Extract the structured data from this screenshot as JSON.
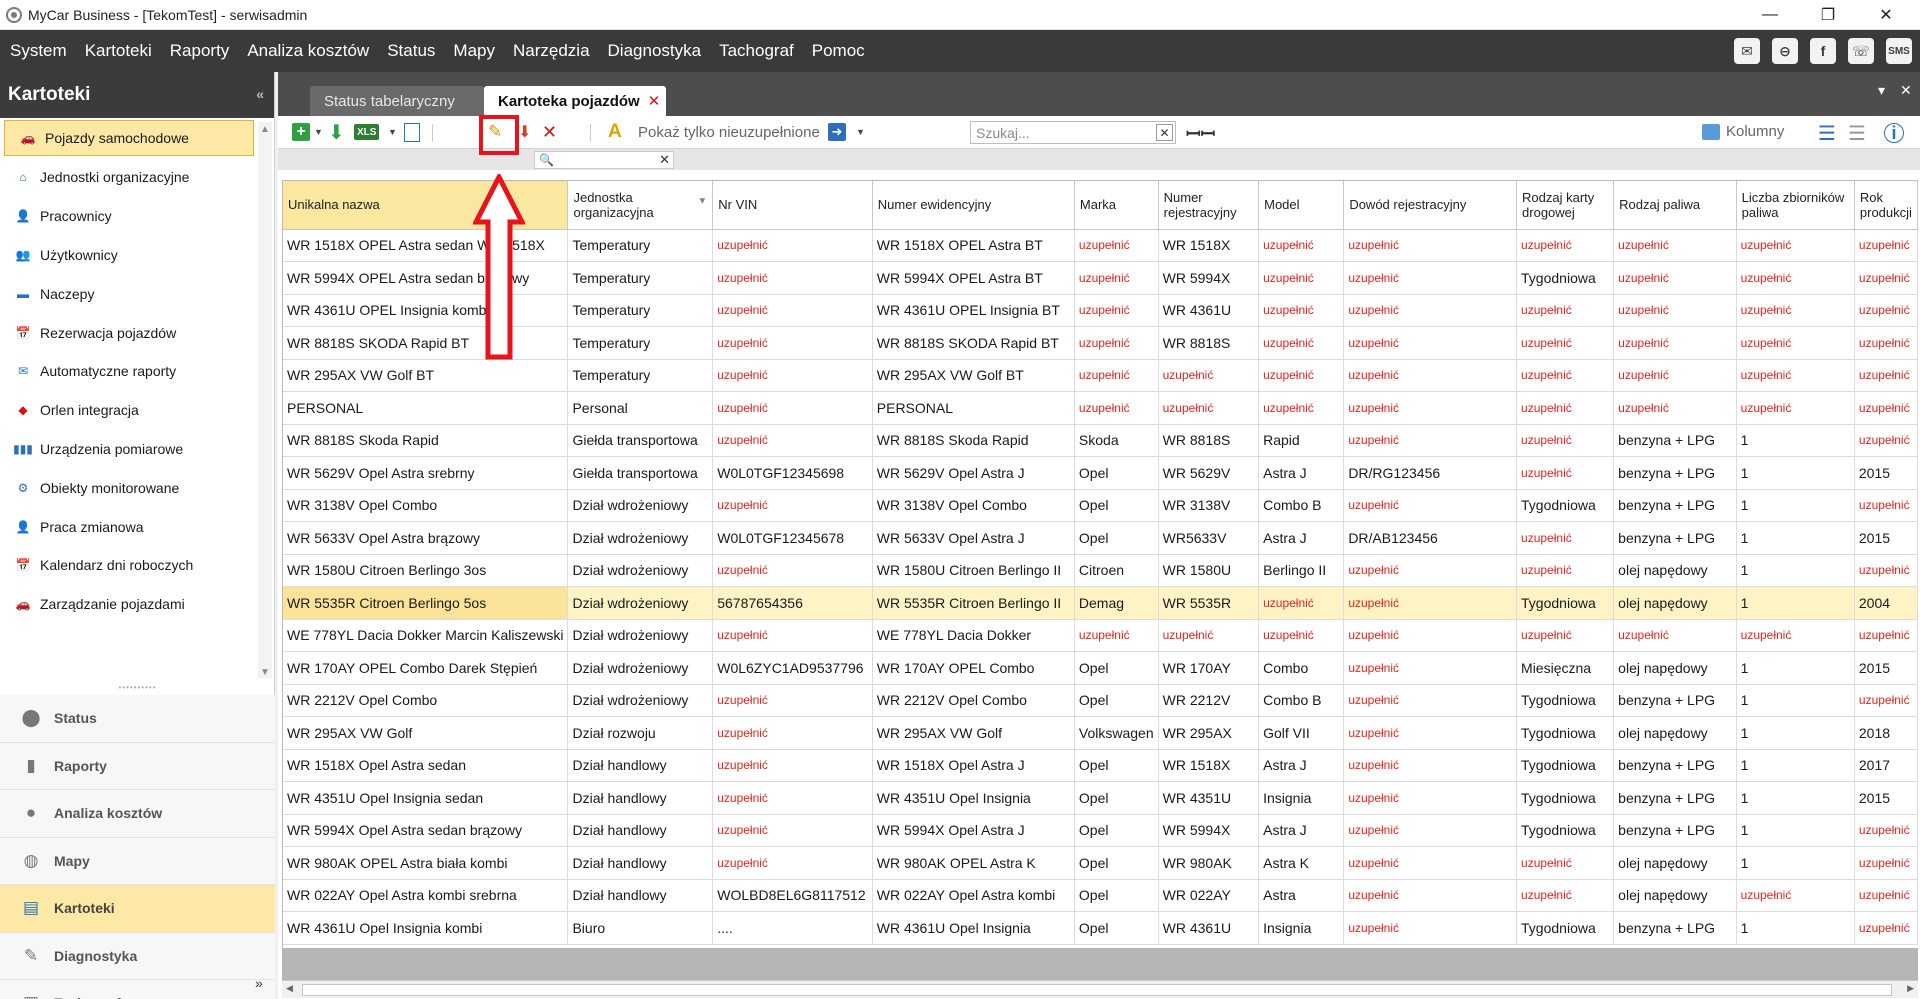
{
  "window": {
    "title": "MyCar Business - [TekomTest] - serwisadmin",
    "controls": {
      "minimize": "—",
      "restore": "❐",
      "close": "✕"
    }
  },
  "menu": {
    "items": [
      "System",
      "Kartoteki",
      "Raporty",
      "Analiza kosztów",
      "Status",
      "Mapy",
      "Narzędzia",
      "Diagnostyka",
      "Tachograf",
      "Pomoc"
    ],
    "sms_label": "SMS"
  },
  "left_panel": {
    "title": "Kartoteki",
    "collapse_glyph": "«",
    "items": [
      {
        "label": "Pojazdy samochodowe",
        "icon": "car-icon",
        "glyph": "🚗"
      },
      {
        "label": "Jednostki organizacyjne",
        "icon": "home-icon",
        "glyph": "⌂"
      },
      {
        "label": "Pracownicy",
        "icon": "person-icon",
        "glyph": "👤"
      },
      {
        "label": "Użytkownicy",
        "icon": "users-icon",
        "glyph": "👥"
      },
      {
        "label": "Naczepy",
        "icon": "trailer-icon",
        "glyph": "▬"
      },
      {
        "label": "Rezerwacja pojazdów",
        "icon": "calendar-icon",
        "glyph": "📅"
      },
      {
        "label": "Automatyczne raporty",
        "icon": "mail-icon",
        "glyph": "✉"
      },
      {
        "label": "Orlen integracja",
        "icon": "orlen-icon",
        "glyph": "◆"
      },
      {
        "label": "Urządzenia pomiarowe",
        "icon": "sensors-icon",
        "glyph": "▮▮▮"
      },
      {
        "label": "Obiekty monitorowane",
        "icon": "monitored-object-icon",
        "glyph": "⚙"
      },
      {
        "label": "Praca zmianowa",
        "icon": "shift-work-icon",
        "glyph": "👤"
      },
      {
        "label": "Kalendarz dni roboczych",
        "icon": "workdays-calendar-icon",
        "glyph": "📅"
      },
      {
        "label": "Zarządzanie pojazdami",
        "icon": "fleet-management-icon",
        "glyph": "🚗"
      }
    ],
    "sections": [
      {
        "label": "Status",
        "icon": "location-pin-icon",
        "glyph": "⬤"
      },
      {
        "label": "Raporty",
        "icon": "bar-chart-icon",
        "glyph": "▮"
      },
      {
        "label": "Analiza kosztów",
        "icon": "coins-icon",
        "glyph": "●"
      },
      {
        "label": "Mapy",
        "icon": "globe-icon",
        "glyph": "◍"
      },
      {
        "label": "Kartoteki",
        "icon": "files-icon",
        "glyph": "▤"
      },
      {
        "label": "Diagnostyka",
        "icon": "wrench-icon",
        "glyph": "✎"
      },
      {
        "label": "Tachograf",
        "icon": "tachograph-icon",
        "glyph": "▦"
      }
    ],
    "more_glyph": "»"
  },
  "tabs": [
    {
      "label": "Status tabelaryczny"
    },
    {
      "label": "Kartoteka pojazdów",
      "close": "✕"
    }
  ],
  "toolbar": {
    "xls_label": "XLS",
    "show_incomplete_label": "Pokaż tylko nieuzupełnione",
    "search_placeholder": "Szukaj...",
    "columns_label": "Kolumny"
  },
  "grid": {
    "columns": [
      "Unikalna nazwa",
      "Jednostka organizacyjna",
      "Nr VIN",
      "Numer ewidencyjny",
      "Marka",
      "Numer rejestracyjny",
      "Model",
      "Dowód rejestracyjny",
      "Rodzaj karty drogowej",
      "Rodzaj paliwa",
      "Liczba zbiorników paliwa",
      "Rok produkcji"
    ],
    "fill_text": "uzupełnić",
    "selected_row": 11,
    "rows": [
      [
        "WR 1518X OPEL Astra sedan WR 1518X",
        "Temperatury",
        "uzupełnić",
        "WR 1518X OPEL Astra BT",
        "uzupełnić",
        "WR 1518X",
        "uzupełnić",
        "uzupełnić",
        "uzupełnić",
        "uzupełnić",
        "uzupełnić",
        "uzupełnić"
      ],
      [
        "WR 5994X OPEL Astra sedan brązowy",
        "Temperatury",
        "uzupełnić",
        "WR 5994X OPEL Astra BT",
        "uzupełnić",
        "WR 5994X",
        "uzupełnić",
        "uzupełnić",
        "Tygodniowa",
        "uzupełnić",
        "uzupełnić",
        "uzupełnić"
      ],
      [
        "WR 4361U OPEL Insignia kombi",
        "Temperatury",
        "uzupełnić",
        "WR 4361U OPEL Insignia BT",
        "uzupełnić",
        "WR 4361U",
        "uzupełnić",
        "uzupełnić",
        "uzupełnić",
        "uzupełnić",
        "uzupełnić",
        "uzupełnić"
      ],
      [
        "WR 8818S SKODA Rapid BT",
        "Temperatury",
        "uzupełnić",
        "WR 8818S SKODA Rapid BT",
        "uzupełnić",
        "WR 8818S",
        "uzupełnić",
        "uzupełnić",
        "uzupełnić",
        "uzupełnić",
        "uzupełnić",
        "uzupełnić"
      ],
      [
        "WR 295AX VW Golf BT",
        "Temperatury",
        "uzupełnić",
        "WR 295AX VW Golf BT",
        "uzupełnić",
        "uzupełnić",
        "uzupełnić",
        "uzupełnić",
        "uzupełnić",
        "uzupełnić",
        "uzupełnić",
        "uzupełnić"
      ],
      [
        "PERSONAL",
        "Personal",
        "uzupełnić",
        "PERSONAL",
        "uzupełnić",
        "uzupełnić",
        "uzupełnić",
        "uzupełnić",
        "uzupełnić",
        "uzupełnić",
        "uzupełnić",
        "uzupełnić"
      ],
      [
        "WR 8818S Skoda Rapid",
        "Giełda transportowa",
        "uzupełnić",
        "WR 8818S Skoda Rapid",
        "Skoda",
        "WR 8818S",
        "Rapid",
        "uzupełnić",
        "uzupełnić",
        "benzyna + LPG",
        "1",
        "uzupełnić"
      ],
      [
        "WR 5629V Opel Astra srebrny",
        "Giełda transportowa",
        "W0L0TGF12345698",
        "WR 5629V Opel Astra J",
        "Opel",
        "WR 5629V",
        "Astra J",
        "DR/RG123456",
        "uzupełnić",
        "benzyna + LPG",
        "1",
        "2015"
      ],
      [
        "WR 3138V Opel Combo",
        "Dział wdrożeniowy",
        "uzupełnić",
        "WR 3138V Opel Combo",
        "Opel",
        "WR 3138V",
        "Combo B",
        "uzupełnić",
        "Tygodniowa",
        "benzyna + LPG",
        "1",
        "uzupełnić"
      ],
      [
        "WR 5633V Opel Astra brązowy",
        "Dział wdrożeniowy",
        "W0L0TGF12345678",
        "WR 5633V Opel Astra J",
        "Opel",
        "WR5633V",
        "Astra J",
        "DR/AB123456",
        "uzupełnić",
        "benzyna + LPG",
        "1",
        "2015"
      ],
      [
        "WR 1580U Citroen Berlingo 3os",
        "Dział wdrożeniowy",
        "uzupełnić",
        "WR 1580U Citroen Berlingo II",
        "Citroen",
        "WR 1580U",
        "Berlingo II",
        "uzupełnić",
        "uzupełnić",
        "olej napędowy",
        "1",
        "uzupełnić"
      ],
      [
        "WR 5535R Citroen Berlingo 5os",
        "Dział wdrożeniowy",
        "56787654356",
        "WR 5535R Citroen Berlingo II",
        "Demag",
        "WR 5535R",
        "uzupełnić",
        "uzupełnić",
        "Tygodniowa",
        "olej napędowy",
        "1",
        "2004"
      ],
      [
        "WE 778YL Dacia Dokker Marcin Kaliszewski",
        "Dział wdrożeniowy",
        "uzupełnić",
        "WE 778YL Dacia Dokker",
        "uzupełnić",
        "uzupełnić",
        "uzupełnić",
        "uzupełnić",
        "uzupełnić",
        "uzupełnić",
        "uzupełnić",
        "uzupełnić"
      ],
      [
        "WR 170AY OPEL Combo Darek Stępień",
        "Dział wdrożeniowy",
        "W0L6ZYC1AD9537796",
        "WR 170AY OPEL Combo",
        "Opel",
        "WR 170AY",
        "Combo",
        "uzupełnić",
        "Miesięczna",
        "olej napędowy",
        "1",
        "2015"
      ],
      [
        "WR 2212V Opel Combo",
        "Dział wdrożeniowy",
        "uzupełnić",
        "WR 2212V Opel Combo",
        "Opel",
        "WR 2212V",
        "Combo B",
        "uzupełnić",
        "Tygodniowa",
        "benzyna + LPG",
        "1",
        "uzupełnić"
      ],
      [
        "WR 295AX VW Golf",
        "Dział rozwoju",
        "uzupełnić",
        "WR 295AX VW Golf",
        "Volkswagen",
        "WR 295AX",
        "Golf VII",
        "uzupełnić",
        "Tygodniowa",
        "olej napędowy",
        "1",
        "2018"
      ],
      [
        "WR 1518X Opel Astra sedan",
        "Dział handlowy",
        "uzupełnić",
        "WR 1518X Opel Astra J",
        "Opel",
        "WR 1518X",
        "Astra J",
        "uzupełnić",
        "Tygodniowa",
        "benzyna + LPG",
        "1",
        "2017"
      ],
      [
        "WR 4351U Opel Insignia sedan",
        "Dział handlowy",
        "uzupełnić",
        "WR 4351U Opel Insignia",
        "Opel",
        "WR 4351U",
        "Insignia",
        "uzupełnić",
        "Tygodniowa",
        "benzyna + LPG",
        "1",
        "2015"
      ],
      [
        "WR 5994X Opel Astra sedan brązowy",
        "Dział handlowy",
        "uzupełnić",
        "WR 5994X Opel Astra J",
        "Opel",
        "WR 5994X",
        "Astra J",
        "uzupełnić",
        "Tygodniowa",
        "benzyna + LPG",
        "1",
        "uzupełnić"
      ],
      [
        "WR 980AK OPEL Astra biała kombi",
        "Dział handlowy",
        "uzupełnić",
        "WR 980AK OPEL Astra K",
        "Opel",
        "WR 980AK",
        "Astra K",
        "uzupełnić",
        "uzupełnić",
        "olej napędowy",
        "1",
        "uzupełnić"
      ],
      [
        "WR 022AY Opel Astra kombi srebrna",
        "Dział handlowy",
        "WOLBD8EL6G8117512",
        "WR 022AY Opel Astra kombi",
        "Opel",
        "WR 022AY",
        "Astra",
        "uzupełnić",
        "uzupełnić",
        "olej napędowy",
        "uzupełnić",
        "uzupełnić"
      ],
      [
        "WR 4361U Opel Insignia kombi",
        "Biuro",
        "....",
        "WR 4361U Opel Insignia",
        "Opel",
        "WR 4361U",
        "Insignia",
        "uzupełnić",
        "Tygodniowa",
        "benzyna + LPG",
        "1",
        "uzupełnić"
      ]
    ]
  },
  "colors": {
    "menubar": "#3a3a3a",
    "accent_yellow": "#fde9a5",
    "fill_red": "#e0261f",
    "annotation_red": "#e8141c",
    "brand_blue": "#2c6fbe"
  }
}
